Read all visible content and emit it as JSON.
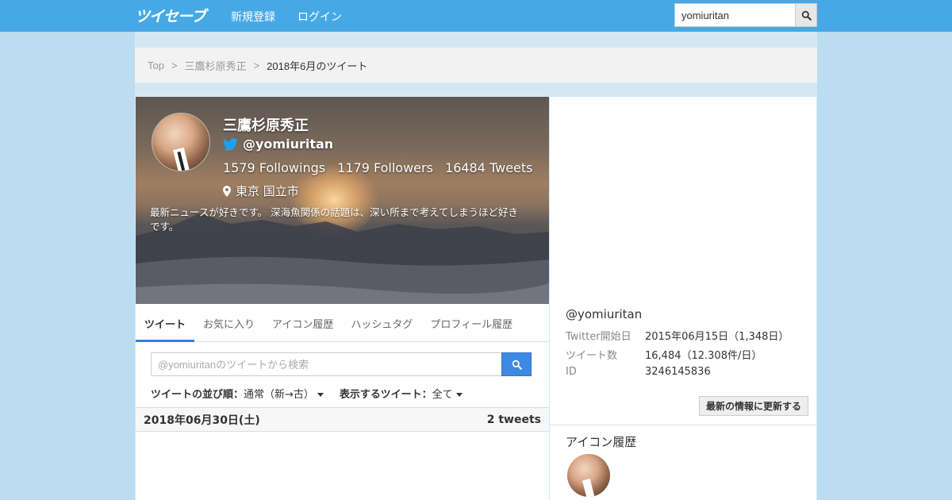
{
  "header": {
    "logo": "ツイセーブ",
    "nav": {
      "signup": "新規登録",
      "login": "ログイン"
    },
    "search": {
      "value": "yomiuritan"
    }
  },
  "breadcrumb": {
    "items": [
      "Top",
      "三鷹杉原秀正"
    ],
    "separator": ">",
    "current": "2018年6月のツイート"
  },
  "profile": {
    "name": "三鷹杉原秀正",
    "handle": "@yomiuritan",
    "followings": "1579 Followings",
    "followers": "1179 Followers",
    "tweets": "16484 Tweets",
    "location": "東京 国立市",
    "bio": "最新ニュースが好きです。 深海魚関係の話題は、深い所まで考えてしまうほど好きです。"
  },
  "tabs": [
    {
      "label": "ツイート",
      "active": true
    },
    {
      "label": "お気に入り",
      "active": false
    },
    {
      "label": "アイコン履歴",
      "active": false
    },
    {
      "label": "ハッシュタグ",
      "active": false
    },
    {
      "label": "プロフィール履歴",
      "active": false
    }
  ],
  "tweet_search": {
    "placeholder": "@yomiuritanのツイートから検索"
  },
  "sort": {
    "order_label": "ツイートの並び順：",
    "order_value": "通常（新→古）",
    "filter_label": "表示するツイート：",
    "filter_value": "全て"
  },
  "date_group": {
    "date": "2018年06月30日(土)",
    "count": "2 tweets"
  },
  "sidebar": {
    "handle": "@yomiuritan",
    "info": [
      {
        "label": "Twitter開始日",
        "value": "2015年06月15日（1,348日）"
      },
      {
        "label": "ツイート数",
        "value": "16,484（12.308件/日）"
      },
      {
        "label": "ID",
        "value": "3246145836"
      }
    ],
    "refresh_label": "最新の情報に更新する",
    "icon_history_title": "アイコン履歴"
  },
  "colors": {
    "topbar": "#46a9e6",
    "background": "#bcdcef",
    "accent": "#3b7cd6",
    "twitter_blue": "#1da1f2"
  },
  "icons": {
    "search": "magnifier-icon",
    "twitter": "twitter-bird-icon",
    "location": "map-pin-icon",
    "caret": "caret-down-icon"
  }
}
